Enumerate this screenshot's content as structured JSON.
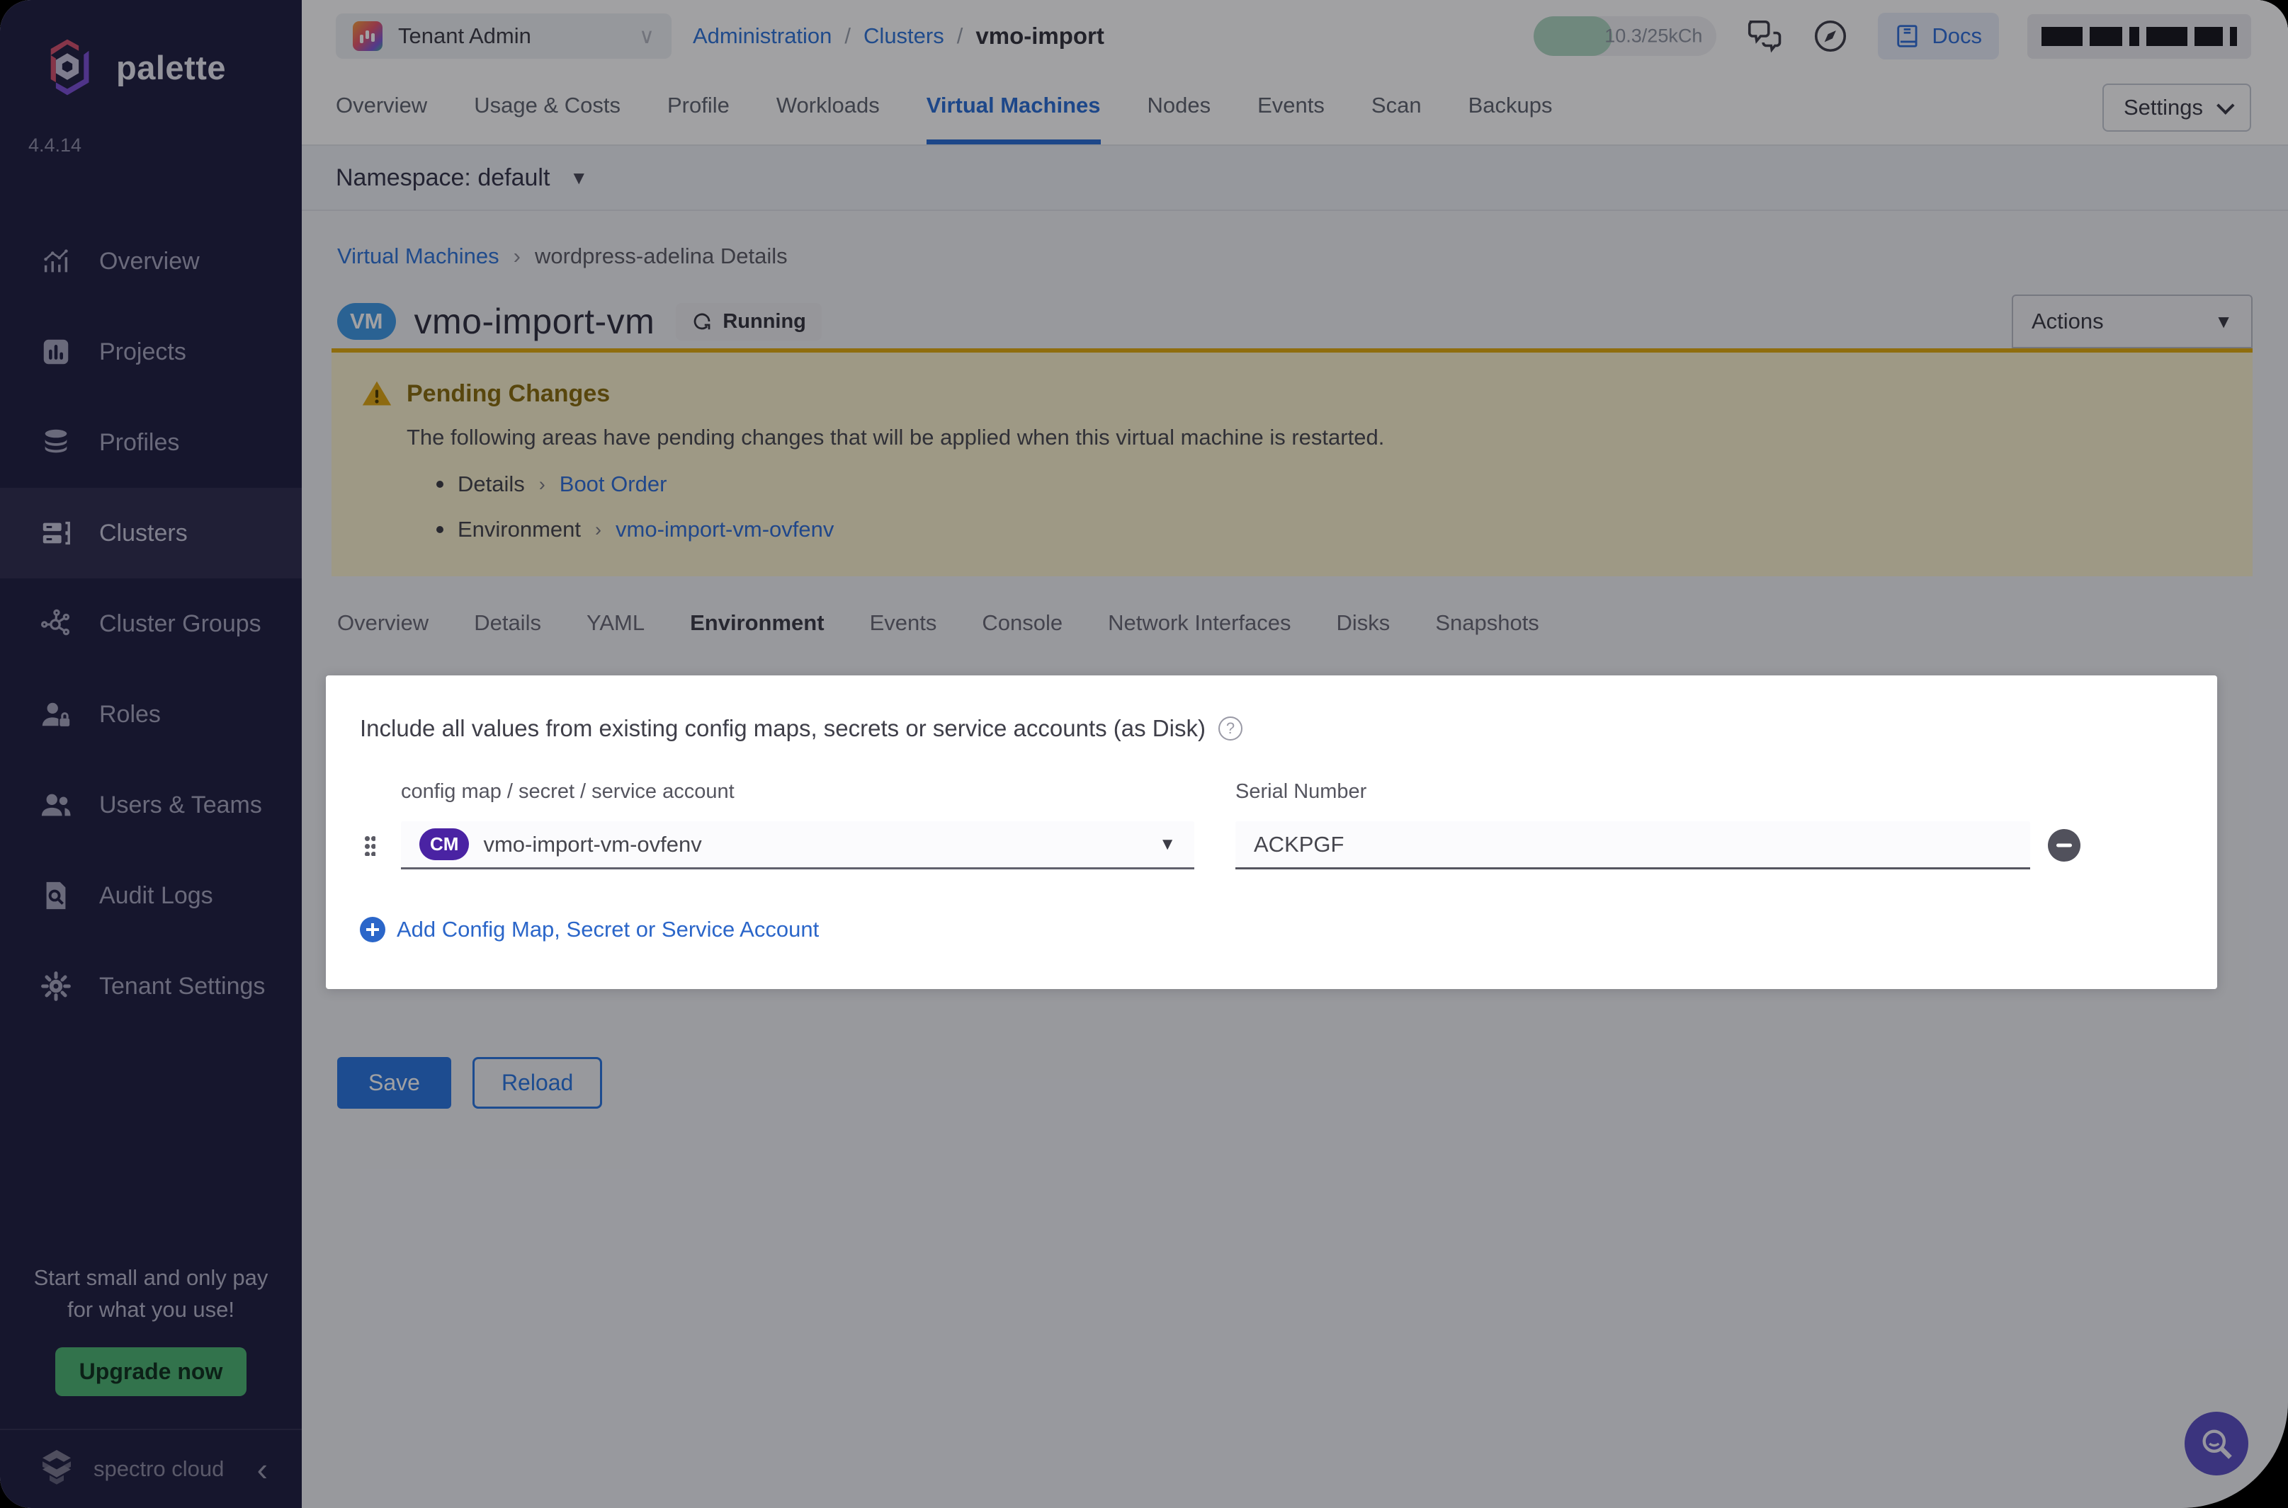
{
  "app": {
    "brand": "palette",
    "version": "4.4.14",
    "footer_brand": "spectro cloud"
  },
  "colors": {
    "accent_blue": "#2b77e1",
    "warning_gold": "#e2ab10",
    "cm_purple": "#4a23a3",
    "upgrade_green": "#4db573",
    "sidebar_navy": "#201f42",
    "vm_badge_blue": "#3f9ae5"
  },
  "topbar": {
    "tenant_selector": "Tenant Admin",
    "breadcrumb": [
      {
        "label": "Administration",
        "type": "link"
      },
      {
        "label": "Clusters",
        "type": "link"
      },
      {
        "label": "vmo-import",
        "type": "current"
      }
    ],
    "usage": "10.3/25kCh",
    "docs_label": "Docs"
  },
  "sidebar": {
    "items": [
      {
        "label": "Overview",
        "icon": "overview-chart-icon",
        "active": false
      },
      {
        "label": "Projects",
        "icon": "projects-icon",
        "active": false
      },
      {
        "label": "Profiles",
        "icon": "profiles-layers-icon",
        "active": false
      },
      {
        "label": "Clusters",
        "icon": "clusters-server-icon",
        "active": true
      },
      {
        "label": "Cluster Groups",
        "icon": "cluster-groups-network-icon",
        "active": false
      },
      {
        "label": "Roles",
        "icon": "roles-user-lock-icon",
        "active": false
      },
      {
        "label": "Users & Teams",
        "icon": "users-teams-icon",
        "active": false
      },
      {
        "label": "Audit Logs",
        "icon": "audit-logs-icon",
        "active": false
      },
      {
        "label": "Tenant Settings",
        "icon": "gear-icon",
        "active": false
      }
    ],
    "upsell_line1": "Start small and only pay",
    "upsell_line2": "for what you use!",
    "upgrade_label": "Upgrade now"
  },
  "tabs": {
    "items": [
      {
        "label": "Overview",
        "active": false
      },
      {
        "label": "Usage & Costs",
        "active": false
      },
      {
        "label": "Profile",
        "active": false
      },
      {
        "label": "Workloads",
        "active": false
      },
      {
        "label": "Virtual Machines",
        "active": true
      },
      {
        "label": "Nodes",
        "active": false
      },
      {
        "label": "Events",
        "active": false
      },
      {
        "label": "Scan",
        "active": false
      },
      {
        "label": "Backups",
        "active": false
      }
    ],
    "settings_label": "Settings"
  },
  "namespace_bar": {
    "label": "Namespace: default"
  },
  "vm_header": {
    "breadcrumb_link": "Virtual Machines",
    "breadcrumb_current": "wordpress-adelina Details",
    "vm_badge": "VM",
    "title": "vmo-import-vm",
    "status": "Running",
    "actions_label": "Actions"
  },
  "pending": {
    "title": "Pending Changes",
    "description": "The following areas have pending changes that will be applied when this virtual machine is restarted.",
    "items": [
      {
        "area": "Details",
        "link": "Boot Order"
      },
      {
        "area": "Environment",
        "link": "vmo-import-vm-ovfenv"
      }
    ]
  },
  "subtabs": {
    "items": [
      {
        "label": "Overview",
        "active": false
      },
      {
        "label": "Details",
        "active": false
      },
      {
        "label": "YAML",
        "active": false
      },
      {
        "label": "Environment",
        "active": true
      },
      {
        "label": "Events",
        "active": false
      },
      {
        "label": "Console",
        "active": false
      },
      {
        "label": "Network Interfaces",
        "active": false
      },
      {
        "label": "Disks",
        "active": false
      },
      {
        "label": "Snapshots",
        "active": false
      }
    ]
  },
  "env_panel": {
    "title": "Include all values from existing config maps, secrets or service accounts (as Disk)",
    "col1_label": "config map / secret / service account",
    "col2_label": "Serial Number",
    "row": {
      "badge": "CM",
      "value": "vmo-import-vm-ovfenv",
      "serial": "ACKPGF"
    },
    "add_label": "Add Config Map, Secret or Service Account"
  },
  "footer_actions": {
    "save": "Save",
    "reload": "Reload"
  }
}
